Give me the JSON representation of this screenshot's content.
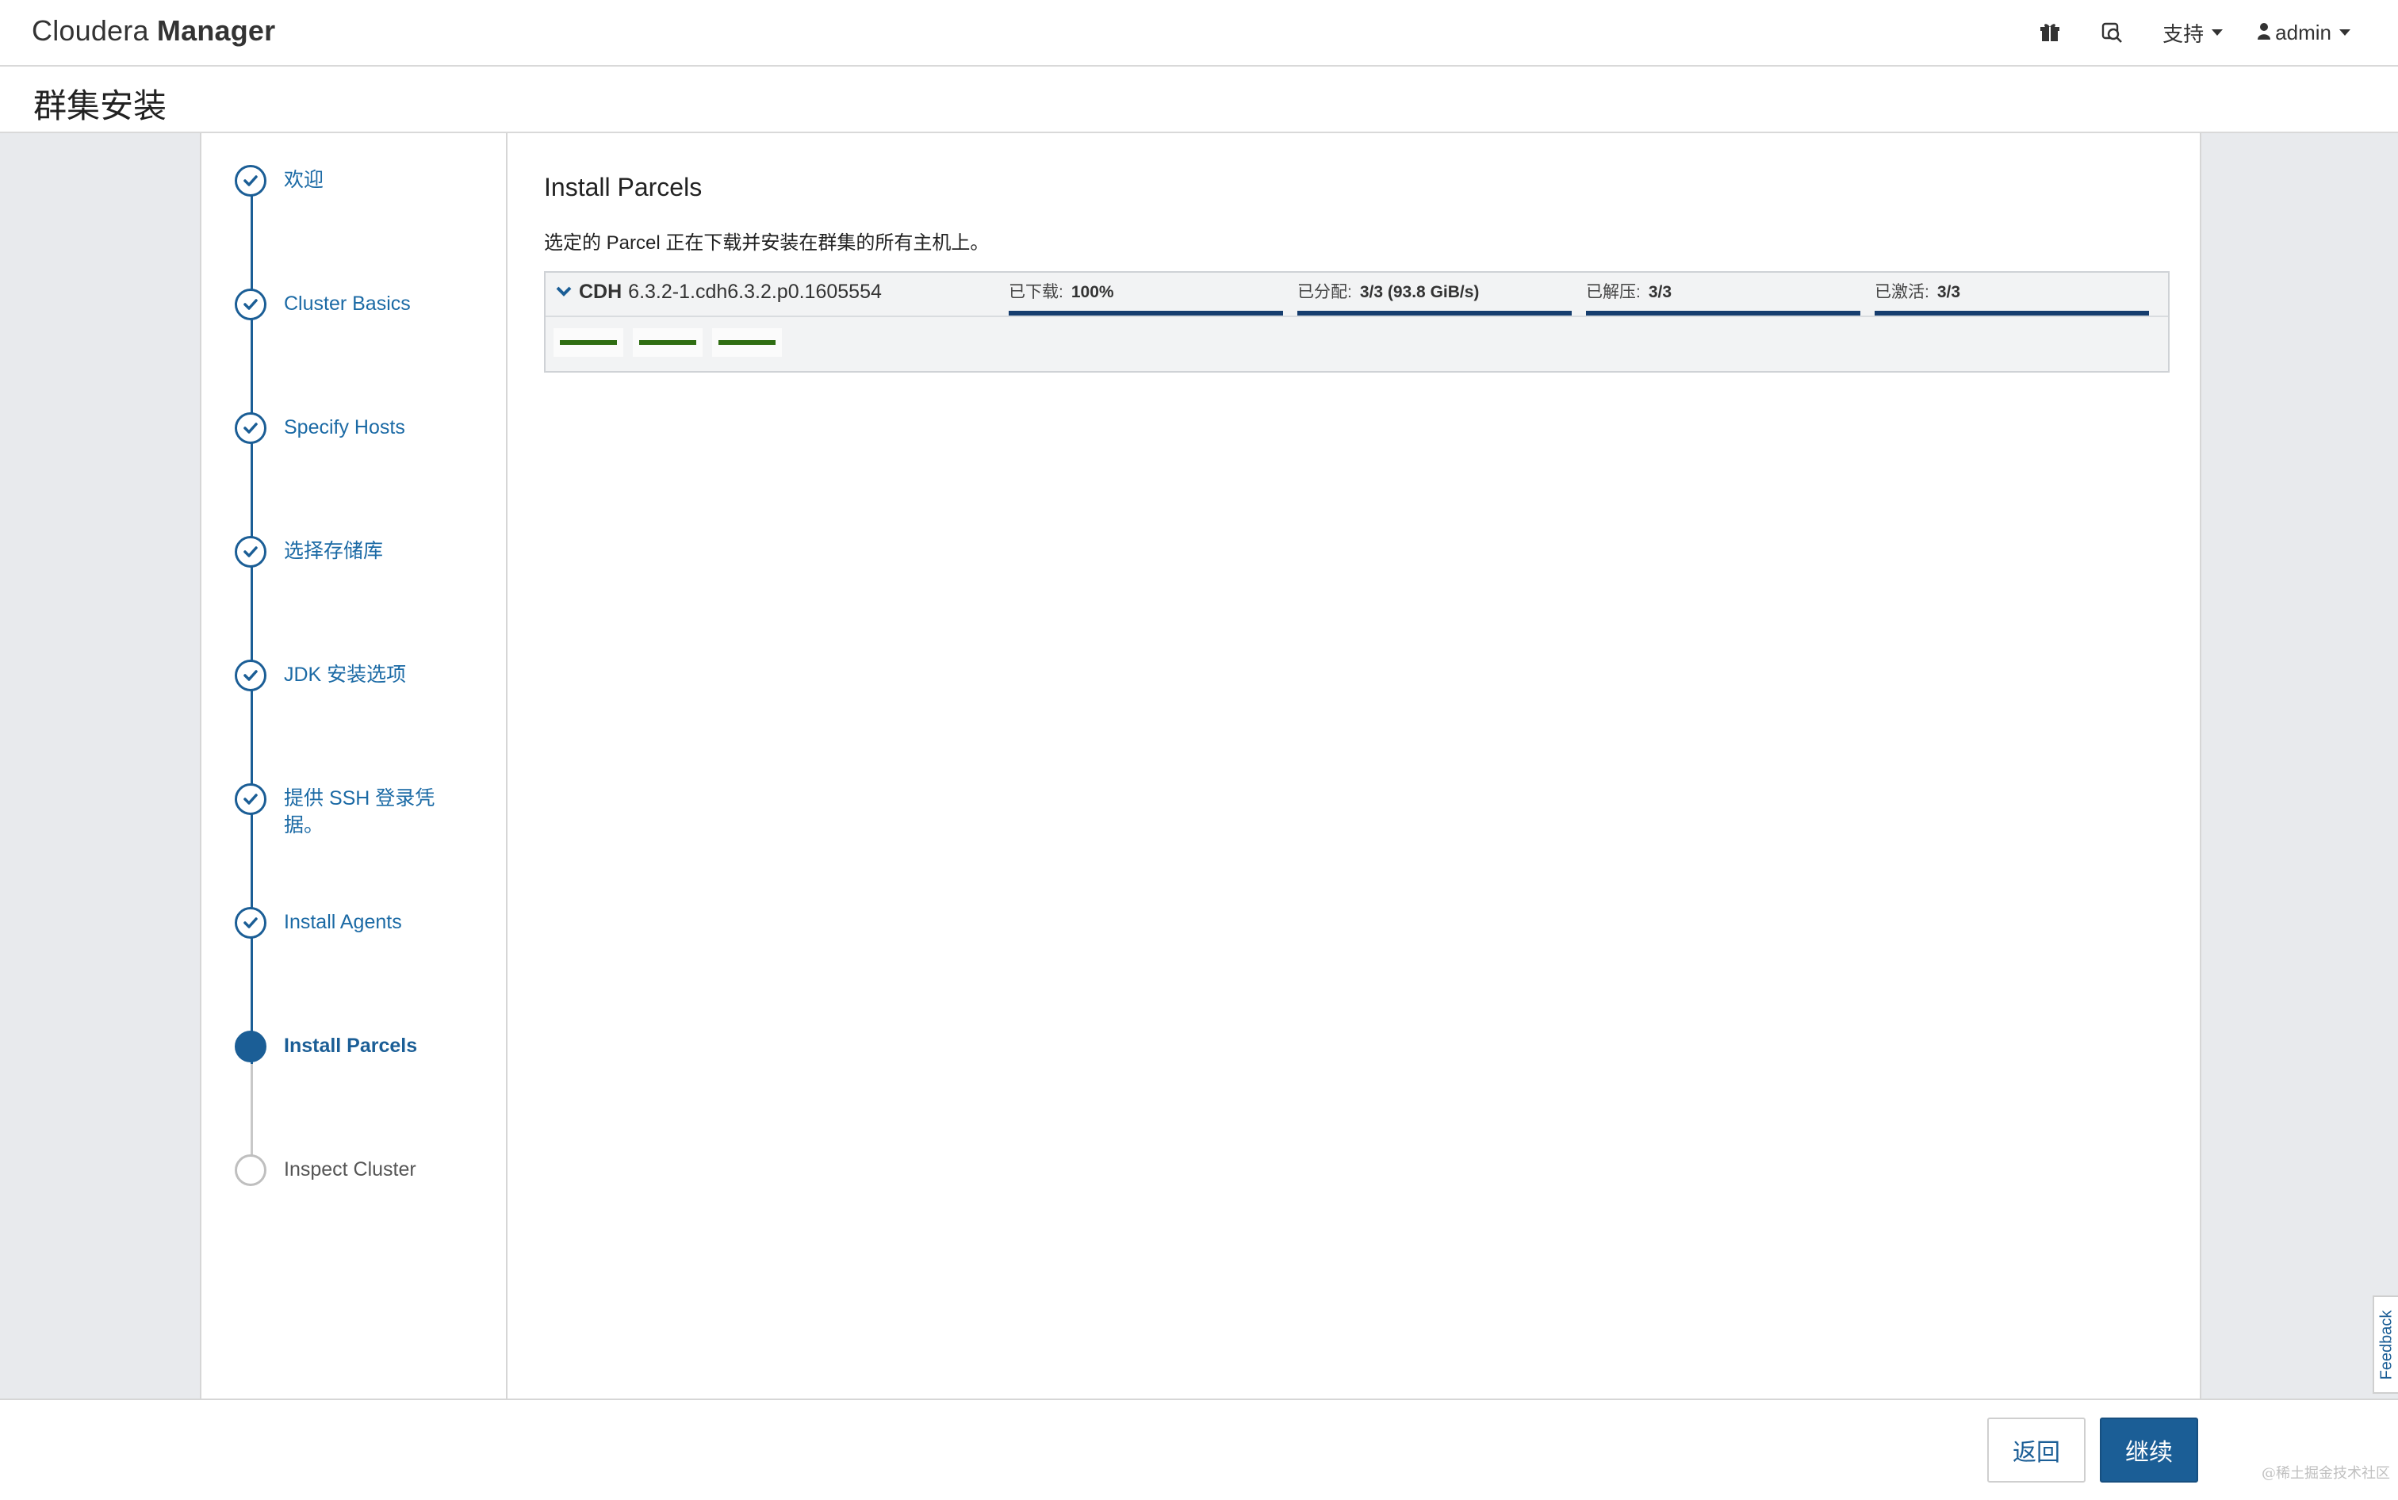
{
  "app": {
    "brand_light": "Cloudera",
    "brand_bold": "Manager"
  },
  "nav": {
    "gift_icon": "gift-icon",
    "search_icon": "search-person-icon",
    "support_label": "支持",
    "user_label": "admin"
  },
  "page": {
    "title": "群集安装"
  },
  "steps": [
    {
      "label": "欢迎",
      "state": "done"
    },
    {
      "label": "Cluster Basics",
      "state": "done"
    },
    {
      "label": "Specify Hosts",
      "state": "done"
    },
    {
      "label": "选择存储库",
      "state": "done"
    },
    {
      "label": "JDK 安装选项",
      "state": "done"
    },
    {
      "label": "提供 SSH 登录凭据。",
      "state": "done"
    },
    {
      "label": "Install Agents",
      "state": "done"
    },
    {
      "label": "Install Parcels",
      "state": "current"
    },
    {
      "label": "Inspect Cluster",
      "state": "todo"
    }
  ],
  "main": {
    "title": "Install Parcels",
    "description": "选定的 Parcel 正在下载并安装在群集的所有主机上。",
    "parcel": {
      "name": "CDH",
      "version": "6.3.2-1.cdh6.3.2.p0.1605554",
      "stats": [
        {
          "label": "已下载:",
          "value": "100%",
          "progress": 1.0
        },
        {
          "label": "已分配:",
          "value": "3/3 (93.8 GiB/s)",
          "progress": 1.0
        },
        {
          "label": "已解压:",
          "value": "3/3",
          "progress": 1.0
        },
        {
          "label": "已激活:",
          "value": "3/3",
          "progress": 1.0
        }
      ],
      "host_count": 3
    }
  },
  "footer": {
    "back_label": "返回",
    "next_label": "继续"
  },
  "feedback_label": "Feedback",
  "watermark": "@稀土掘金技术社区",
  "colors": {
    "accent": "#1b5e96",
    "progress_fill": "#163d6e",
    "host_bar": "#2f6d12"
  }
}
